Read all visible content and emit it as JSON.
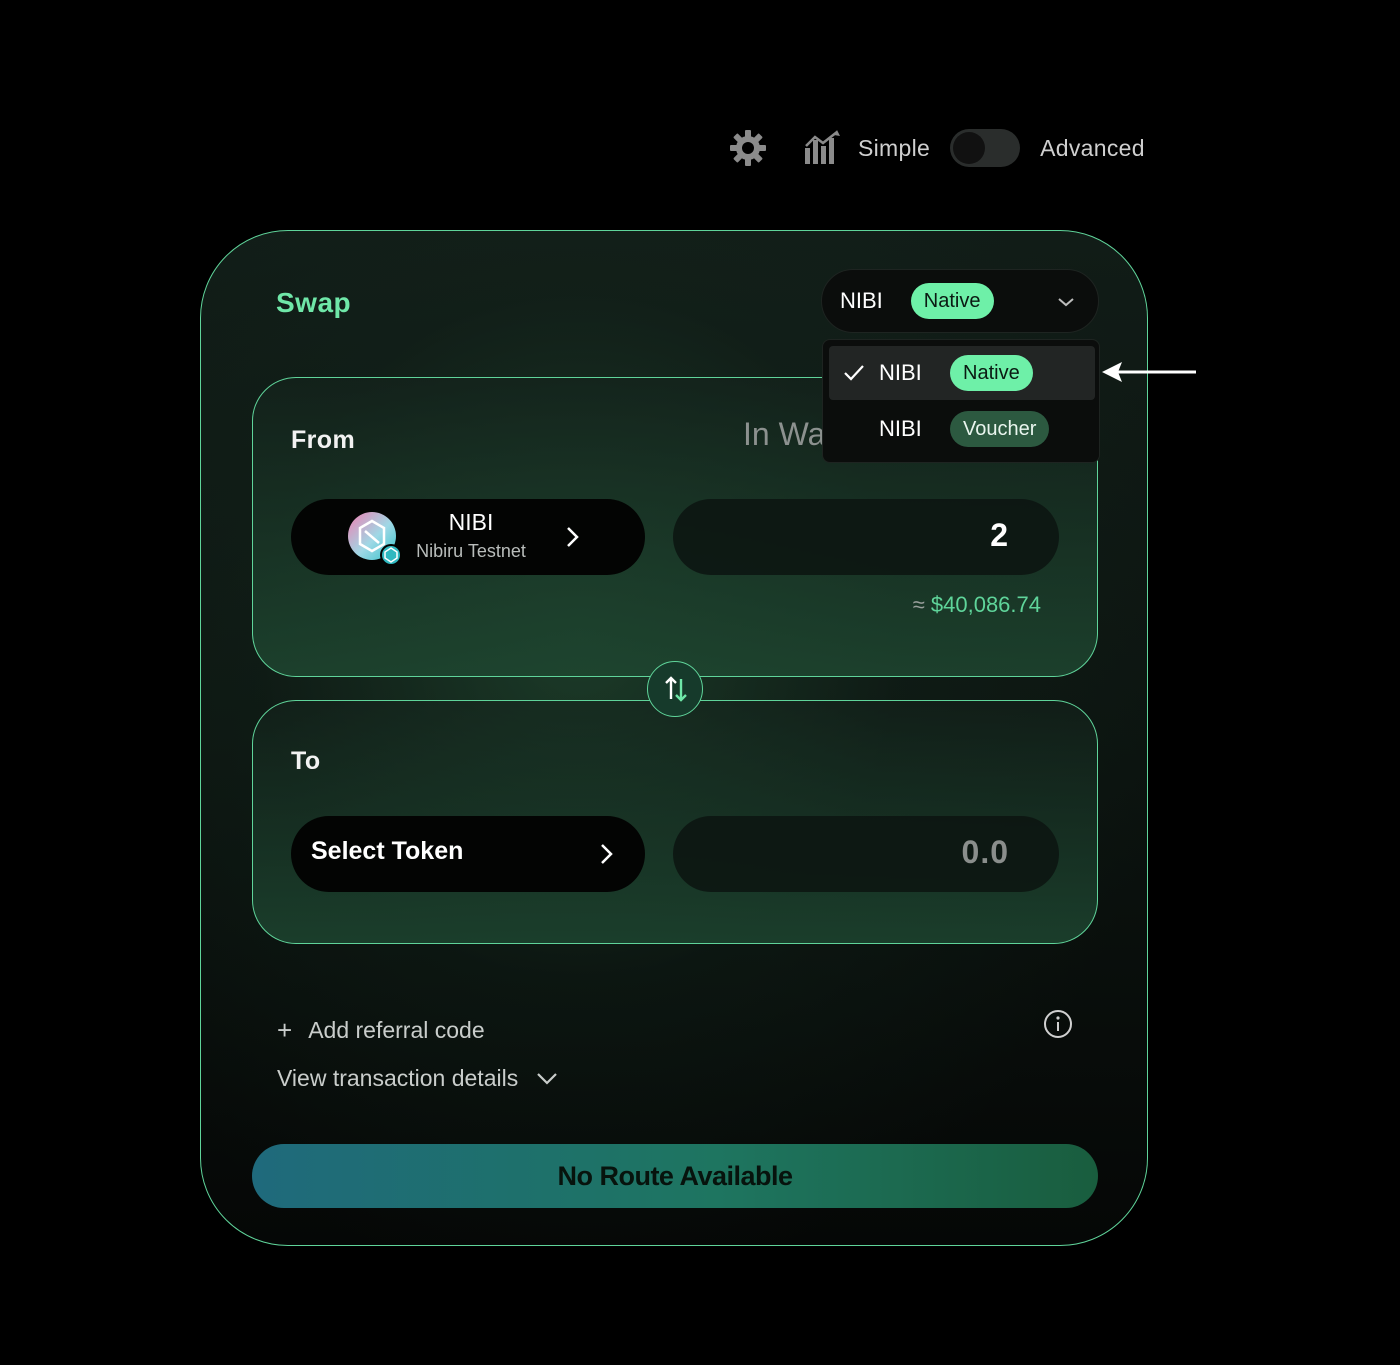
{
  "topbar": {
    "settings_icon": "gear-icon",
    "chart_icon": "chart-bars-icon",
    "mode_simple": "Simple",
    "mode_advanced": "Advanced",
    "mode_toggle_on": false
  },
  "card": {
    "title": "Swap",
    "token_select": {
      "name": "NIBI",
      "badge": "Native"
    },
    "dropdown": {
      "items": [
        {
          "name": "NIBI",
          "badge": "Native",
          "selected": true
        },
        {
          "name": "NIBI",
          "badge": "Voucher",
          "selected": false
        }
      ]
    },
    "from": {
      "label": "From",
      "in_wallet_label": "In Wa",
      "token": {
        "name": "NIBI",
        "chain": "Nibiru Testnet"
      },
      "amount": "2",
      "usd_approx": "≈",
      "usd_value": "$40,086.74"
    },
    "to": {
      "label": "To",
      "select_label": "Select Token",
      "amount_placeholder": "0.0"
    },
    "referral": {
      "plus": "+",
      "label": "Add referral code"
    },
    "tx_details": {
      "label": "View transaction details"
    },
    "cta": {
      "label": "No Route Available"
    }
  },
  "colors": {
    "accent": "#6fe7a8",
    "border": "#5fd49a",
    "native_pill": "#6ef0a8",
    "voucher_pill": "#2c5940"
  }
}
